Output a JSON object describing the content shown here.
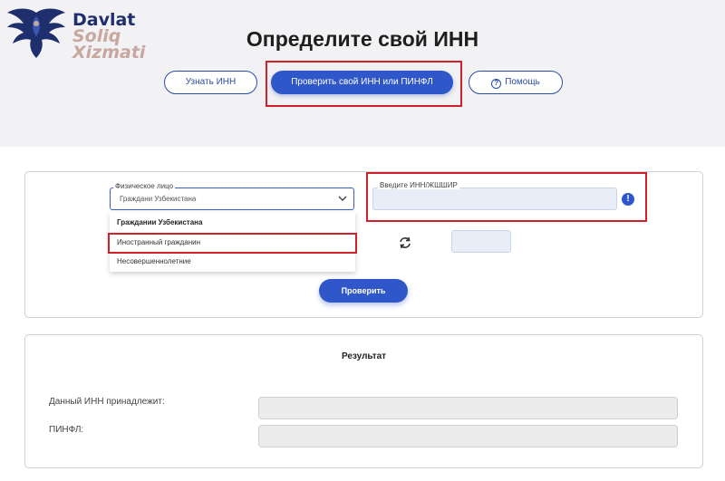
{
  "logo": {
    "line1": "Davlat",
    "line2": "Soliq",
    "line3": "Xizmati"
  },
  "page_title": "Определите свой ИНН",
  "tabs": {
    "find_inn": "Узнать ИНН",
    "check_inn": "Проверить свой ИНН или ПИНФЛ",
    "help": "Помощь"
  },
  "form": {
    "person_type_label": "Физическое лицо",
    "person_type_value": "Граждани Узбекистана",
    "options": [
      "Граждании Узбекистана",
      "Иностранный гражданин",
      "Несовершеннолетние"
    ],
    "inn_label": "Введите ИНН/ЖШШИР",
    "inn_value": "",
    "captcha_value": "",
    "submit_label": "Проверить"
  },
  "result": {
    "title": "Результат",
    "owner_label": "Данный ИНН принадлежит:",
    "owner_value": "",
    "pinfl_label": "ПИНФЛ:",
    "pinfl_value": ""
  },
  "colors": {
    "primary": "#2f57c9",
    "highlight": "#d0212b",
    "brand_navy": "#1f2f6e",
    "brand_rose": "#c8a7a0"
  }
}
